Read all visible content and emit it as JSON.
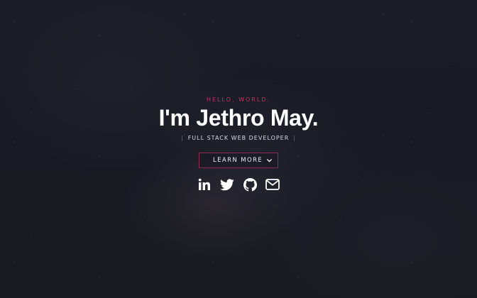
{
  "hero": {
    "greeting": "HELLO, WORLD.",
    "name": "I'm Jethro May.",
    "role": "FULL STACK WEB DEVELOPER",
    "role_divider": "|"
  },
  "cta": {
    "label": "LEARN MORE",
    "icon": "chevron-down-icon"
  },
  "socials": [
    {
      "name": "LinkedIn",
      "icon": "linkedin-icon"
    },
    {
      "name": "Twitter",
      "icon": "twitter-icon"
    },
    {
      "name": "GitHub",
      "icon": "github-icon"
    },
    {
      "name": "Email",
      "icon": "envelope-icon"
    }
  ],
  "colors": {
    "accent": "#cf2f66",
    "button_border": "#8c2b4f",
    "text": "#ffffff",
    "background": "#181a23"
  }
}
